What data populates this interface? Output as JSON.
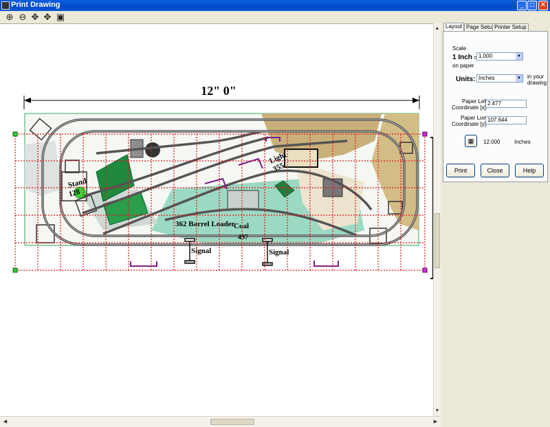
{
  "window": {
    "title": "Print Drawing",
    "minimize": "_",
    "maximize": "□",
    "close": "✕"
  },
  "toolbar": [
    {
      "name": "zoom-in-icon",
      "glyph": "⊕"
    },
    {
      "name": "zoom-out-icon",
      "glyph": "⊖"
    },
    {
      "name": "pan-icon",
      "glyph": "✥"
    },
    {
      "name": "move-icon",
      "glyph": "✥"
    },
    {
      "name": "fit-page-icon",
      "glyph": "▣"
    }
  ],
  "drawing": {
    "dimension": "12\" 0\"",
    "labels": {
      "stand": "Stand",
      "stand_num": "128",
      "light": "Light",
      "light_num": "355",
      "barrel": "362 Barrel Loader",
      "coal": "Coal",
      "coal_num": "497",
      "signal1": "Signal",
      "signal2": "Signal"
    }
  },
  "panel": {
    "tabs": [
      "Layout",
      "Page Setup",
      "Printer Setup"
    ],
    "scale_label": "Scale",
    "one_inch": "1 Inch",
    "equals": "=",
    "scale_value": "1.000",
    "on_paper": "on paper",
    "units_label": "Units:",
    "units_value": "Inches",
    "in_your": "in your",
    "drawing": "drawing",
    "paper_left_l1": "Paper Left",
    "paper_left_l2": "Coordinate  [x]:",
    "paper_left_value": "2.477",
    "paper_lower_l1": "Paper Lower",
    "paper_lower_l2": "Coordinate  [y]:",
    "paper_lower_value": "107.644",
    "size_value": "12.000",
    "size_units": "Inches",
    "print": "Print",
    "close": "Close",
    "help": "Help"
  }
}
